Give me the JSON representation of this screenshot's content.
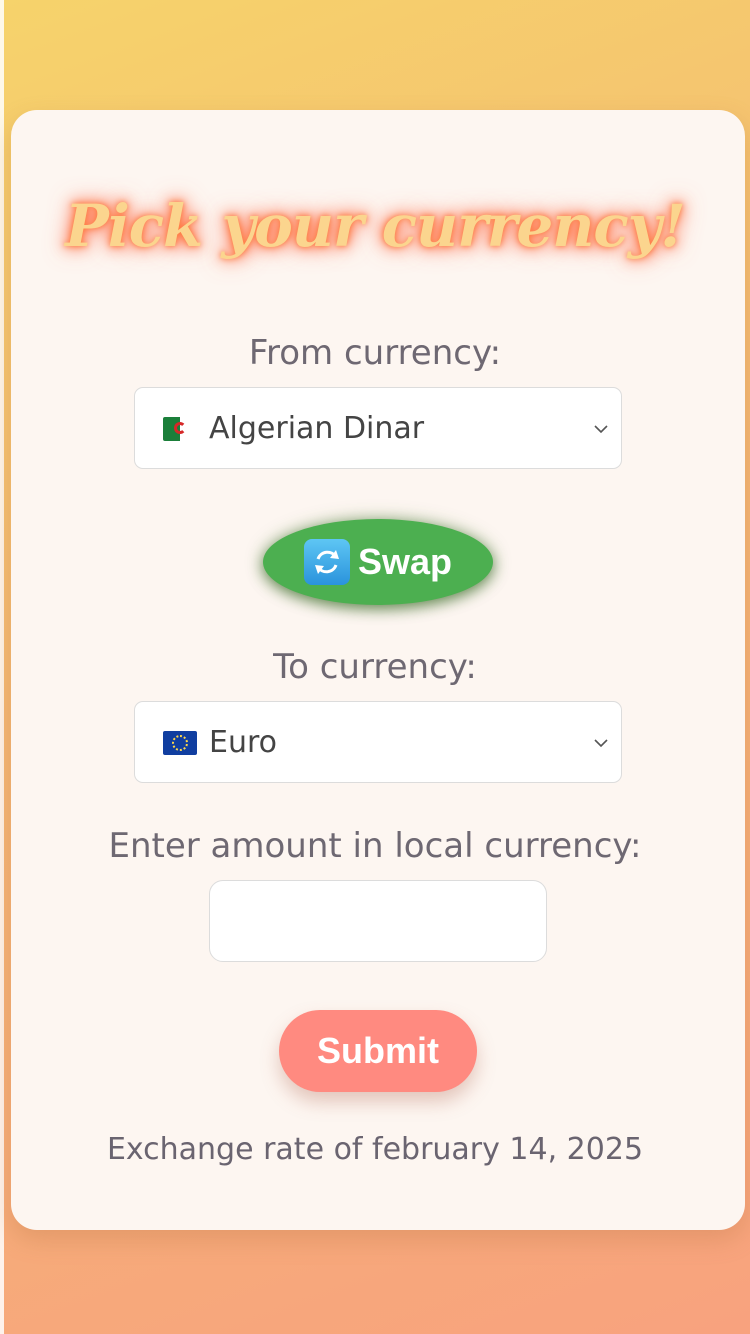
{
  "title": "Pick your currency!",
  "from": {
    "label": "From currency:",
    "selected": "Algerian Dinar",
    "flag": "algeria-flag-icon"
  },
  "swap": {
    "label": "Swap",
    "icon": "swap-arrows-icon",
    "color": "#4caf50"
  },
  "to": {
    "label": "To currency:",
    "selected": "Euro",
    "flag": "eu-flag-icon"
  },
  "amount": {
    "label": "Enter amount in local currency:",
    "value": "",
    "placeholder": ""
  },
  "submit": {
    "label": "Submit",
    "color": "#ff8a80"
  },
  "footer": {
    "note": "Exchange rate of february 14, 2025"
  },
  "colors": {
    "background_top": "#f6d36b",
    "background_bottom": "#f8a27e",
    "card": "#fdf6f1",
    "title_text": "#fbd58e",
    "title_glow": "#ff6b3a"
  }
}
